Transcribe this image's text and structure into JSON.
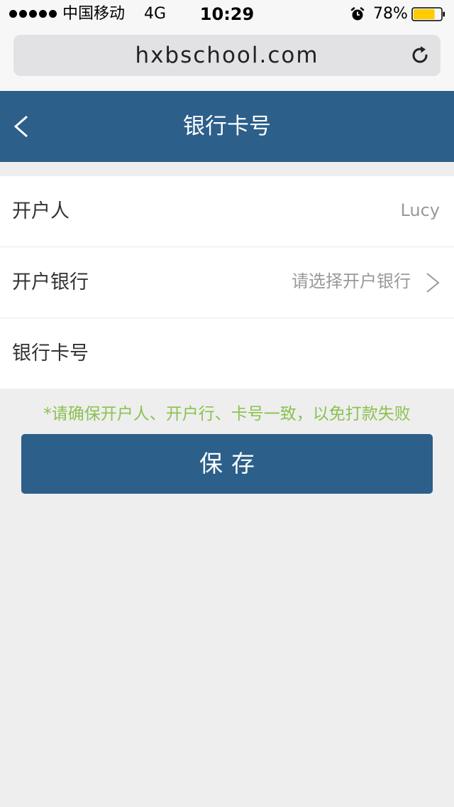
{
  "status_bar": {
    "carrier": "中国移动",
    "network": "4G",
    "time": "10:29",
    "battery_percent": "78%",
    "battery_level": 0.78,
    "battery_color": "#ffcc00"
  },
  "browser": {
    "url": "hxbschool.com",
    "reload_icon": "reload-icon"
  },
  "header": {
    "title": "银行卡号",
    "back_icon": "back-icon"
  },
  "form": {
    "account_holder": {
      "label": "开户人",
      "value": "Lucy"
    },
    "bank": {
      "label": "开户银行",
      "placeholder": "请选择开户银行",
      "icon": "chevron-right-icon"
    },
    "card_number": {
      "label": "银行卡号",
      "value": ""
    }
  },
  "notice": "*请确保开户人、开户行、卡号一致，以免打款失败",
  "save_button": {
    "label": "保存"
  },
  "colors": {
    "header_bg": "#2c5f8a",
    "notice": "#8cc152",
    "page_bg": "#eeeeee"
  }
}
